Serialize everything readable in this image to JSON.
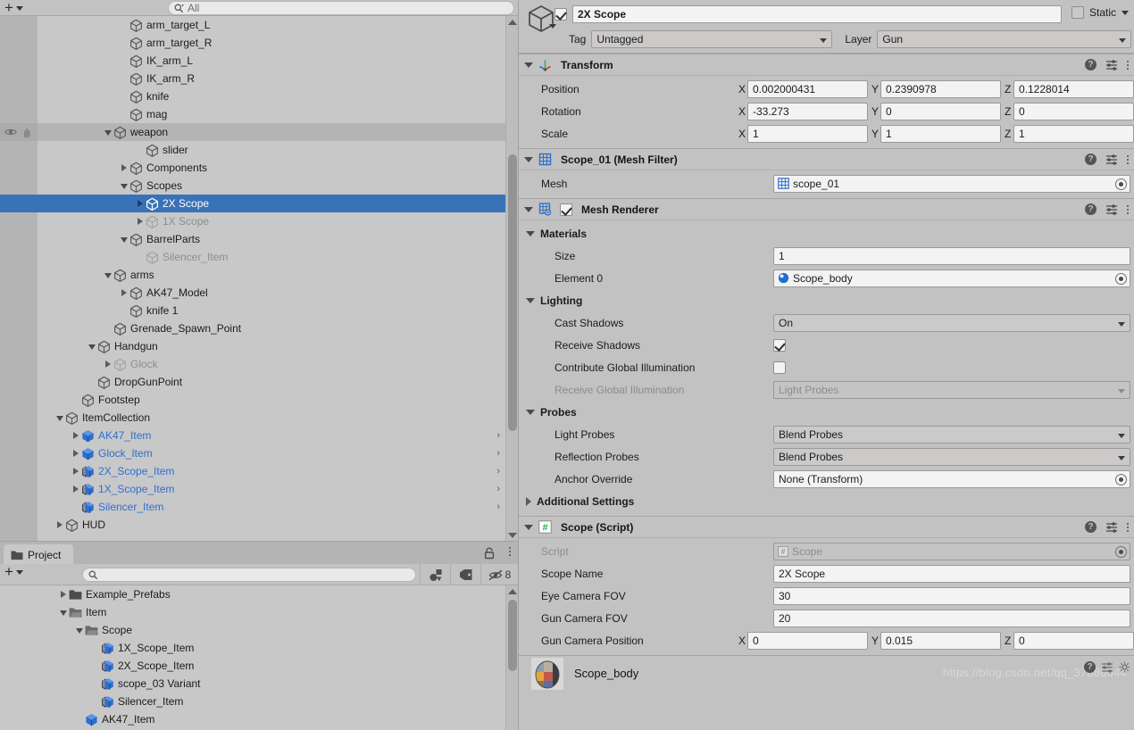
{
  "hierarchy": {
    "toolbar": {
      "add_label": "+",
      "search_placeholder": "All",
      "search_value": ""
    },
    "items": [
      {
        "label": "arm_target_L",
        "depth": 5,
        "arrow": "none",
        "icon": "gameobject-cube-icon",
        "state": "normal",
        "sel": false,
        "chev": false,
        "alt": false
      },
      {
        "label": "arm_target_R",
        "depth": 5,
        "arrow": "none",
        "icon": "gameobject-cube-icon",
        "state": "normal",
        "sel": false,
        "chev": false,
        "alt": false
      },
      {
        "label": "IK_arm_L",
        "depth": 5,
        "arrow": "none",
        "icon": "gameobject-cube-icon",
        "state": "normal",
        "sel": false,
        "chev": false,
        "alt": false
      },
      {
        "label": "IK_arm_R",
        "depth": 5,
        "arrow": "none",
        "icon": "gameobject-cube-icon",
        "state": "normal",
        "sel": false,
        "chev": false,
        "alt": false
      },
      {
        "label": "knife",
        "depth": 5,
        "arrow": "none",
        "icon": "gameobject-cube-icon",
        "state": "normal",
        "sel": false,
        "chev": false,
        "alt": false
      },
      {
        "label": "mag",
        "depth": 5,
        "arrow": "none",
        "icon": "gameobject-cube-icon",
        "state": "normal",
        "sel": false,
        "chev": false,
        "alt": false
      },
      {
        "label": "weapon",
        "depth": 4,
        "arrow": "down",
        "icon": "gameobject-cube-icon",
        "state": "normal",
        "sel": false,
        "chev": false,
        "alt": true
      },
      {
        "label": "slider",
        "depth": 6,
        "arrow": "none",
        "icon": "gameobject-cube-icon",
        "state": "normal",
        "sel": false,
        "chev": false,
        "alt": false
      },
      {
        "label": "Components",
        "depth": 5,
        "arrow": "right",
        "icon": "gameobject-cube-icon",
        "state": "normal",
        "sel": false,
        "chev": false,
        "alt": false
      },
      {
        "label": "Scopes",
        "depth": 5,
        "arrow": "down",
        "icon": "gameobject-cube-icon",
        "state": "normal",
        "sel": false,
        "chev": false,
        "alt": false
      },
      {
        "label": "2X Scope",
        "depth": 6,
        "arrow": "right",
        "icon": "gameobject-cube-icon",
        "state": "normal",
        "sel": true,
        "chev": false,
        "alt": false
      },
      {
        "label": "1X Scope",
        "depth": 6,
        "arrow": "right",
        "icon": "gameobject-cube-icon",
        "state": "dim",
        "sel": false,
        "chev": false,
        "alt": false
      },
      {
        "label": "BarrelParts",
        "depth": 5,
        "arrow": "down",
        "icon": "gameobject-cube-icon",
        "state": "normal",
        "sel": false,
        "chev": false,
        "alt": false
      },
      {
        "label": "Silencer_Item",
        "depth": 6,
        "arrow": "none",
        "icon": "gameobject-cube-icon",
        "state": "dim",
        "sel": false,
        "chev": false,
        "alt": false
      },
      {
        "label": "arms",
        "depth": 4,
        "arrow": "down",
        "icon": "gameobject-cube-icon",
        "state": "normal",
        "sel": false,
        "chev": false,
        "alt": false
      },
      {
        "label": "AK47_Model",
        "depth": 5,
        "arrow": "right",
        "icon": "gameobject-cube-icon",
        "state": "normal",
        "sel": false,
        "chev": false,
        "alt": false
      },
      {
        "label": "knife 1",
        "depth": 5,
        "arrow": "none",
        "icon": "gameobject-cube-icon",
        "state": "normal",
        "sel": false,
        "chev": false,
        "alt": false
      },
      {
        "label": "Grenade_Spawn_Point",
        "depth": 4,
        "arrow": "none",
        "icon": "gameobject-cube-icon",
        "state": "normal",
        "sel": false,
        "chev": false,
        "alt": false
      },
      {
        "label": "Handgun",
        "depth": 3,
        "arrow": "down",
        "icon": "gameobject-cube-icon",
        "state": "normal",
        "sel": false,
        "chev": false,
        "alt": false
      },
      {
        "label": "Glock",
        "depth": 4,
        "arrow": "right",
        "icon": "gameobject-cube-icon",
        "state": "dim",
        "sel": false,
        "chev": false,
        "alt": false
      },
      {
        "label": "DropGunPoint",
        "depth": 3,
        "arrow": "none",
        "icon": "gameobject-cube-icon",
        "state": "normal",
        "sel": false,
        "chev": false,
        "alt": false
      },
      {
        "label": "Footstep",
        "depth": 2,
        "arrow": "none",
        "icon": "gameobject-cube-icon",
        "state": "normal",
        "sel": false,
        "chev": false,
        "alt": false
      },
      {
        "label": "ItemCollection",
        "depth": 1,
        "arrow": "down",
        "icon": "gameobject-cube-icon",
        "state": "normal",
        "sel": false,
        "chev": false,
        "alt": false
      },
      {
        "label": "AK47_Item",
        "depth": 2,
        "arrow": "right",
        "icon": "prefab-cube-icon",
        "state": "prefab",
        "sel": false,
        "chev": true,
        "alt": false
      },
      {
        "label": "Glock_Item",
        "depth": 2,
        "arrow": "right",
        "icon": "prefab-cube-icon",
        "state": "prefab",
        "sel": false,
        "chev": true,
        "alt": false
      },
      {
        "label": "2X_Scope_Item",
        "depth": 2,
        "arrow": "right",
        "icon": "prefab-variant-cube-icon",
        "state": "prefab",
        "sel": false,
        "chev": true,
        "alt": false
      },
      {
        "label": "1X_Scope_Item",
        "depth": 2,
        "arrow": "right",
        "icon": "prefab-variant-cube-icon",
        "state": "prefab",
        "sel": false,
        "chev": true,
        "alt": false
      },
      {
        "label": "Silencer_Item",
        "depth": 2,
        "arrow": "none",
        "icon": "prefab-variant-cube-icon",
        "state": "prefab",
        "sel": false,
        "chev": true,
        "alt": false
      },
      {
        "label": "HUD",
        "depth": 1,
        "arrow": "right",
        "icon": "gameobject-cube-icon",
        "state": "normal",
        "sel": false,
        "chev": false,
        "alt": false
      }
    ]
  },
  "project": {
    "tab_label": "Project",
    "toolbar": {
      "add_label": "+",
      "search_placeholder": "",
      "search_value": "",
      "hidden_count": "8"
    },
    "items": [
      {
        "label": "Example_Prefabs",
        "depth": 1,
        "arrow": "right",
        "icon": "folder-icon",
        "open": false
      },
      {
        "label": "Item",
        "depth": 1,
        "arrow": "down",
        "icon": "folder-open-icon",
        "open": true
      },
      {
        "label": "Scope",
        "depth": 2,
        "arrow": "down",
        "icon": "folder-open-icon",
        "open": true
      },
      {
        "label": "1X_Scope_Item",
        "depth": 3,
        "arrow": "none",
        "icon": "prefab-variant-cube-icon",
        "open": false
      },
      {
        "label": "2X_Scope_Item",
        "depth": 3,
        "arrow": "none",
        "icon": "prefab-variant-cube-icon",
        "open": false
      },
      {
        "label": "scope_03 Variant",
        "depth": 3,
        "arrow": "none",
        "icon": "prefab-variant-cube-icon",
        "open": false
      },
      {
        "label": "Silencer_Item",
        "depth": 3,
        "arrow": "none",
        "icon": "prefab-variant-cube-icon",
        "open": false
      },
      {
        "label": "AK47_Item",
        "depth": 2,
        "arrow": "none",
        "icon": "prefab-cube-icon",
        "open": false
      }
    ]
  },
  "inspector": {
    "header": {
      "enabled": true,
      "name": "2X Scope",
      "static_label": "Static",
      "tag_label": "Tag",
      "tag_value": "Untagged",
      "layer_label": "Layer",
      "layer_value": "Gun"
    },
    "transform": {
      "title": "Transform",
      "rows": [
        {
          "label": "Position",
          "x": "0.002000431",
          "y": "0.2390978",
          "z": "0.1228014"
        },
        {
          "label": "Rotation",
          "x": "-33.273",
          "y": "0",
          "z": "0"
        },
        {
          "label": "Scale",
          "x": "1",
          "y": "1",
          "z": "1"
        }
      ],
      "axis": {
        "x": "X",
        "y": "Y",
        "z": "Z"
      }
    },
    "mesh_filter": {
      "title": "Scope_01 (Mesh Filter)",
      "mesh_label": "Mesh",
      "mesh_value": "scope_01"
    },
    "mesh_renderer": {
      "title": "Mesh Renderer",
      "enabled": true,
      "materials_label": "Materials",
      "size_label": "Size",
      "size_value": "1",
      "element0_label": "Element 0",
      "element0_value": "Scope_body",
      "lighting_label": "Lighting",
      "cast_shadows_label": "Cast Shadows",
      "cast_shadows_value": "On",
      "receive_shadows_label": "Receive Shadows",
      "receive_shadows_value": true,
      "contribute_gi_label": "Contribute Global Illumination",
      "contribute_gi_value": false,
      "receive_gi_label": "Receive Global Illumination",
      "receive_gi_value": "Light Probes",
      "probes_label": "Probes",
      "light_probes_label": "Light Probes",
      "light_probes_value": "Blend Probes",
      "reflection_probes_label": "Reflection Probes",
      "reflection_probes_value": "Blend Probes",
      "anchor_override_label": "Anchor Override",
      "anchor_override_value": "None (Transform)",
      "additional_settings_label": "Additional Settings"
    },
    "scope_script": {
      "title": "Scope (Script)",
      "script_label": "Script",
      "script_value": "Scope",
      "scope_name_label": "Scope Name",
      "scope_name_value": "2X Scope",
      "eye_fov_label": "Eye Camera FOV",
      "eye_fov_value": "30",
      "gun_fov_label": "Gun Camera FOV",
      "gun_fov_value": "20",
      "gun_cam_pos_label": "Gun Camera Position",
      "gun_cam_pos_x": "0",
      "gun_cam_pos_y": "0.015",
      "gun_cam_pos_z": "0"
    },
    "material_strip": {
      "name": "Scope_body",
      "watermark": "https://blog.csdn.net/qq_37886644"
    }
  },
  "colors": {
    "selection_blue": "#3a72b8",
    "prefab_blue": "#2f6fce",
    "panel_bg": "#c2c2c2",
    "tree_bg": "#c8c8c8",
    "field_bg": "#f3f3f3"
  }
}
